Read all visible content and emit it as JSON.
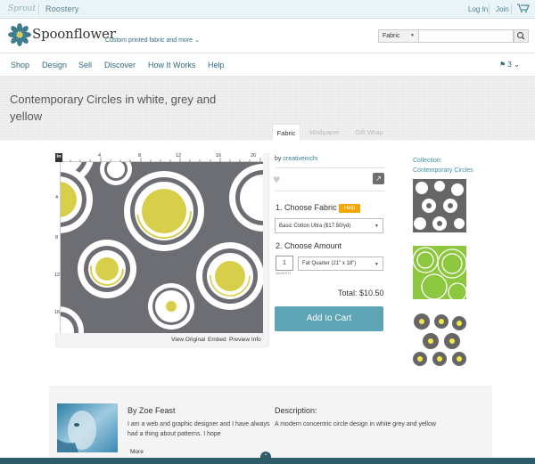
{
  "topbar": {
    "brand_sprout": "Sprout",
    "brand_roostery": "Roostery",
    "login": "Log In",
    "join": "Join"
  },
  "header": {
    "logo": "Spoonflower",
    "tagline": "Custom printed fabric and more",
    "search_category": "Fabric",
    "search_placeholder": ""
  },
  "nav": {
    "items": [
      "Shop",
      "Design",
      "Sell",
      "Discover",
      "How It Works",
      "Help"
    ],
    "region": "3"
  },
  "product": {
    "title": "Contemporary Circles in white, grey and yellow",
    "tabs": [
      "Fabric",
      "Wallpaper",
      "Gift Wrap"
    ],
    "by_label": "by",
    "designer_link": "creativeinchi",
    "step1": "1. Choose Fabric",
    "help": "Help",
    "fabric_selected": "Basic Cotton Ultra ($17.50/yd)",
    "step2": "2. Choose Amount",
    "quantity": "1",
    "quantity_label": "QUANTITY",
    "amount_selected": "Fat Quarter (21\" x 18\")",
    "total": "Total: $10.50",
    "add_to_cart": "Add to Cart"
  },
  "preview": {
    "unit": "in",
    "ruler_top": [
      "4",
      "8",
      "12",
      "16",
      "20"
    ],
    "ruler_left": [
      "4",
      "8",
      "12",
      "16"
    ],
    "links": [
      "View Original",
      "Embed",
      "Preview Info"
    ],
    "colors": {
      "grey": "#6d6e73",
      "yellow": "#d7cf4a",
      "white": "#ffffff"
    }
  },
  "collection": {
    "label": "Collection:",
    "name": "Contemporary Circles"
  },
  "designer": {
    "name": "By Zoe Feast",
    "bio": "I am a web and graphic designer and I have always had a thing about patterns. I hope",
    "more": "More",
    "desc_title": "Description:",
    "desc_text": "A modern concentric circle design in white grey and yellow"
  }
}
